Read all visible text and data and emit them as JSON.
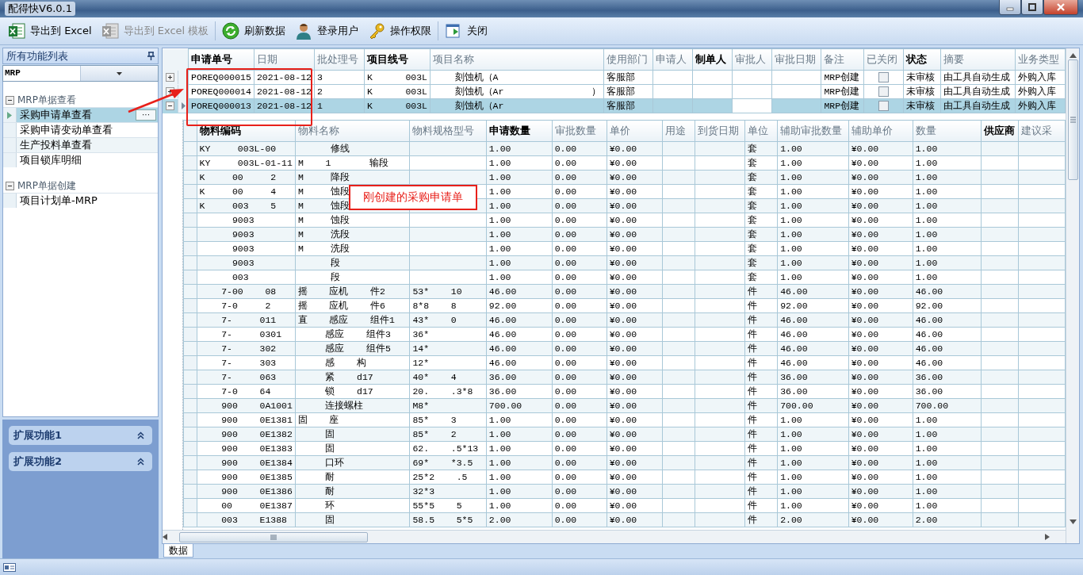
{
  "window": {
    "title": "配得快V6.0.1"
  },
  "toolbar": [
    {
      "label": "导出到 Excel",
      "kind": "excel",
      "disabled": false
    },
    {
      "label": "导出到 Excel 模板",
      "kind": "excel",
      "disabled": true
    },
    {
      "label": "刷新数据",
      "kind": "refresh",
      "disabled": false
    },
    {
      "label": "登录用户",
      "kind": "user",
      "disabled": false
    },
    {
      "label": "操作权限",
      "kind": "key",
      "disabled": false
    },
    {
      "label": "关闭",
      "kind": "exit",
      "disabled": false
    }
  ],
  "sidebar": {
    "title": "所有功能列表",
    "module": "MRP",
    "groups": [
      {
        "label": "MRP单据查看",
        "expanded": true,
        "items": [
          {
            "label": "采购申请单查看",
            "selected": true,
            "action": "···"
          },
          {
            "label": "采购申请变动单查看",
            "selected": false
          },
          {
            "label": "生产投料单查看",
            "selected": false
          },
          {
            "label": "项目锁库明细",
            "selected": false
          }
        ]
      },
      {
        "label": "MRP单据创建",
        "expanded": true,
        "items": [
          {
            "label": "项目计划单-MRP",
            "selected": false
          }
        ]
      }
    ],
    "panels": [
      {
        "label": "扩展功能1",
        "expanded": true
      },
      {
        "label": "扩展功能2",
        "expanded": true
      }
    ]
  },
  "master_table": {
    "columns": [
      {
        "label": "申请单号",
        "emphasized": true
      },
      {
        "label": "日期",
        "emphasized": false
      },
      {
        "label": "批处理号",
        "emphasized": false
      },
      {
        "label": "项目线号",
        "emphasized": true
      },
      {
        "label": "项目名称",
        "emphasized": false
      },
      {
        "label": "使用部门",
        "emphasized": false
      },
      {
        "label": "申请人",
        "emphasized": false
      },
      {
        "label": "制单人",
        "emphasized": true
      },
      {
        "label": "审批人",
        "emphasized": false
      },
      {
        "label": "审批日期",
        "emphasized": false
      },
      {
        "label": "备注",
        "emphasized": false
      },
      {
        "label": "已关闭",
        "emphasized": false
      },
      {
        "label": "状态",
        "emphasized": true
      },
      {
        "label": "摘要",
        "emphasized": false
      },
      {
        "label": "业务类型",
        "emphasized": false
      }
    ],
    "rows": [
      {
        "selected": false,
        "expanded": false,
        "cells": [
          "POREQ000015",
          "2021-08-12",
          "3",
          "K      003L",
          "    刻蚀机（A",
          "客服部",
          "",
          "",
          "",
          "",
          "MRP创建",
          "",
          "未审核",
          "由工具自动生成",
          "外购入库"
        ],
        "closed": false
      },
      {
        "selected": false,
        "expanded": false,
        "cells": [
          "POREQ000014",
          "2021-08-12",
          "2",
          "K      003L",
          "    刻蚀机（Ar                ）",
          "客服部",
          "",
          "",
          "",
          "",
          "MRP创建",
          "",
          "未审核",
          "由工具自动生成",
          "外购入库"
        ],
        "closed": false
      },
      {
        "selected": true,
        "expanded": true,
        "cells": [
          "POREQ000013",
          "2021-08-12",
          "1",
          "K      003L",
          "    刻蚀机（Ar",
          "客服部",
          "",
          "",
          "",
          "",
          "MRP创建",
          "",
          "未审核",
          "由工具自动生成",
          "外购入库"
        ],
        "closed": false
      }
    ]
  },
  "detail_table": {
    "columns": [
      {
        "label": "物料编码",
        "emphasized": true
      },
      {
        "label": "物料名称",
        "emphasized": false
      },
      {
        "label": "物料规格型号",
        "emphasized": false
      },
      {
        "label": "申请数量",
        "emphasized": true
      },
      {
        "label": "审批数量",
        "emphasized": false
      },
      {
        "label": "单价",
        "emphasized": false
      },
      {
        "label": "用途",
        "emphasized": false
      },
      {
        "label": "到货日期",
        "emphasized": false
      },
      {
        "label": "单位",
        "emphasized": false
      },
      {
        "label": "辅助审批数量",
        "emphasized": false
      },
      {
        "label": "辅助单价",
        "emphasized": false
      },
      {
        "label": "数量",
        "emphasized": false
      },
      {
        "label": "供应商",
        "emphasized": true
      },
      {
        "label": "建议采",
        "emphasized": false
      }
    ],
    "rows": [
      [
        "KY     003L-00",
        "      修线",
        "",
        "1.00",
        "0.00",
        "¥0.00",
        "",
        "",
        "套",
        "1.00",
        "¥0.00",
        "1.00",
        "",
        ""
      ],
      [
        "KY     003L-01-11",
        "M    1       输段",
        "",
        "1.00",
        "0.00",
        "¥0.00",
        "",
        "",
        "套",
        "1.00",
        "¥0.00",
        "1.00",
        "",
        ""
      ],
      [
        "K     00     2",
        "M     降段",
        "",
        "1.00",
        "0.00",
        "¥0.00",
        "",
        "",
        "套",
        "1.00",
        "¥0.00",
        "1.00",
        "",
        ""
      ],
      [
        "K     00     4",
        "M     蚀段",
        "",
        "1.00",
        "0.00",
        "¥0.00",
        "",
        "",
        "套",
        "1.00",
        "¥0.00",
        "1.00",
        "",
        ""
      ],
      [
        "K     003    5",
        "M     蚀段",
        "",
        "1.00",
        "0.00",
        "¥0.00",
        "",
        "",
        "套",
        "1.00",
        "¥0.00",
        "1.00",
        "",
        ""
      ],
      [
        "      9003",
        "M     蚀段",
        "",
        "1.00",
        "0.00",
        "¥0.00",
        "",
        "",
        "套",
        "1.00",
        "¥0.00",
        "1.00",
        "",
        ""
      ],
      [
        "      9003",
        "M     洗段",
        "",
        "1.00",
        "0.00",
        "¥0.00",
        "",
        "",
        "套",
        "1.00",
        "¥0.00",
        "1.00",
        "",
        ""
      ],
      [
        "      9003",
        "M     洗段",
        "",
        "1.00",
        "0.00",
        "¥0.00",
        "",
        "",
        "套",
        "1.00",
        "¥0.00",
        "1.00",
        "",
        ""
      ],
      [
        "      9003",
        "      段",
        "",
        "1.00",
        "0.00",
        "¥0.00",
        "",
        "",
        "套",
        "1.00",
        "¥0.00",
        "1.00",
        "",
        ""
      ],
      [
        "      003",
        "      段",
        "",
        "1.00",
        "0.00",
        "¥0.00",
        "",
        "",
        "套",
        "1.00",
        "¥0.00",
        "1.00",
        "",
        ""
      ],
      [
        "    7-00    08",
        "摇    应机    件2",
        "53*    10",
        "46.00",
        "0.00",
        "¥0.00",
        "",
        "",
        "件",
        "46.00",
        "¥0.00",
        "46.00",
        "",
        ""
      ],
      [
        "    7-0     2",
        "摇    应机    件6",
        "8*8    8",
        "92.00",
        "0.00",
        "¥0.00",
        "",
        "",
        "件",
        "92.00",
        "¥0.00",
        "92.00",
        "",
        ""
      ],
      [
        "    7-     011",
        "直    感应    组件1",
        "43*    0",
        "46.00",
        "0.00",
        "¥0.00",
        "",
        "",
        "件",
        "46.00",
        "¥0.00",
        "46.00",
        "",
        ""
      ],
      [
        "    7-     0301",
        "     感应    组件3",
        "36*",
        "46.00",
        "0.00",
        "¥0.00",
        "",
        "",
        "件",
        "46.00",
        "¥0.00",
        "46.00",
        "",
        ""
      ],
      [
        "    7-     302",
        "     感应    组件5",
        "14*",
        "46.00",
        "0.00",
        "¥0.00",
        "",
        "",
        "件",
        "46.00",
        "¥0.00",
        "46.00",
        "",
        ""
      ],
      [
        "    7-     303",
        "     感    构",
        "12*",
        "46.00",
        "0.00",
        "¥0.00",
        "",
        "",
        "件",
        "46.00",
        "¥0.00",
        "46.00",
        "",
        ""
      ],
      [
        "    7-     063",
        "     紧    d17",
        "40*    4",
        "36.00",
        "0.00",
        "¥0.00",
        "",
        "",
        "件",
        "36.00",
        "¥0.00",
        "36.00",
        "",
        ""
      ],
      [
        "    7-0    64",
        "     锁    d17",
        "20.    .3*8",
        "36.00",
        "0.00",
        "¥0.00",
        "",
        "",
        "件",
        "36.00",
        "¥0.00",
        "36.00",
        "",
        ""
      ],
      [
        "    900    0A1001",
        "     连接螺柱",
        "M8*",
        "700.00",
        "0.00",
        "¥0.00",
        "",
        "",
        "件",
        "700.00",
        "¥0.00",
        "700.00",
        "",
        ""
      ],
      [
        "    900    0E1381",
        "固    座",
        "85*    3",
        "1.00",
        "0.00",
        "¥0.00",
        "",
        "",
        "件",
        "1.00",
        "¥0.00",
        "1.00",
        "",
        ""
      ],
      [
        "    900    0E1382",
        "     固",
        "85*    2",
        "1.00",
        "0.00",
        "¥0.00",
        "",
        "",
        "件",
        "1.00",
        "¥0.00",
        "1.00",
        "",
        ""
      ],
      [
        "    900    0E1383",
        "     固",
        "62.    .5*13",
        "1.00",
        "0.00",
        "¥0.00",
        "",
        "",
        "件",
        "1.00",
        "¥0.00",
        "1.00",
        "",
        ""
      ],
      [
        "    900    0E1384",
        "     口环",
        "69*    *3.5",
        "1.00",
        "0.00",
        "¥0.00",
        "",
        "",
        "件",
        "1.00",
        "¥0.00",
        "1.00",
        "",
        ""
      ],
      [
        "    900    0E1385",
        "     耐",
        "25*2    .5",
        "1.00",
        "0.00",
        "¥0.00",
        "",
        "",
        "件",
        "1.00",
        "¥0.00",
        "1.00",
        "",
        ""
      ],
      [
        "    900    0E1386",
        "     耐",
        "32*3",
        "1.00",
        "0.00",
        "¥0.00",
        "",
        "",
        "件",
        "1.00",
        "¥0.00",
        "1.00",
        "",
        ""
      ],
      [
        "    00     0E1387",
        "     环",
        "55*5    5",
        "1.00",
        "0.00",
        "¥0.00",
        "",
        "",
        "件",
        "1.00",
        "¥0.00",
        "1.00",
        "",
        ""
      ],
      [
        "    003    E1388",
        "     固",
        "58.5    5*5",
        "2.00",
        "0.00",
        "¥0.00",
        "",
        "",
        "件",
        "2.00",
        "¥0.00",
        "2.00",
        "",
        ""
      ]
    ]
  },
  "annotation": {
    "note": "刚创建的采购申请单"
  },
  "bottom_tabs": [
    {
      "label": "数据",
      "selected": true
    }
  ]
}
